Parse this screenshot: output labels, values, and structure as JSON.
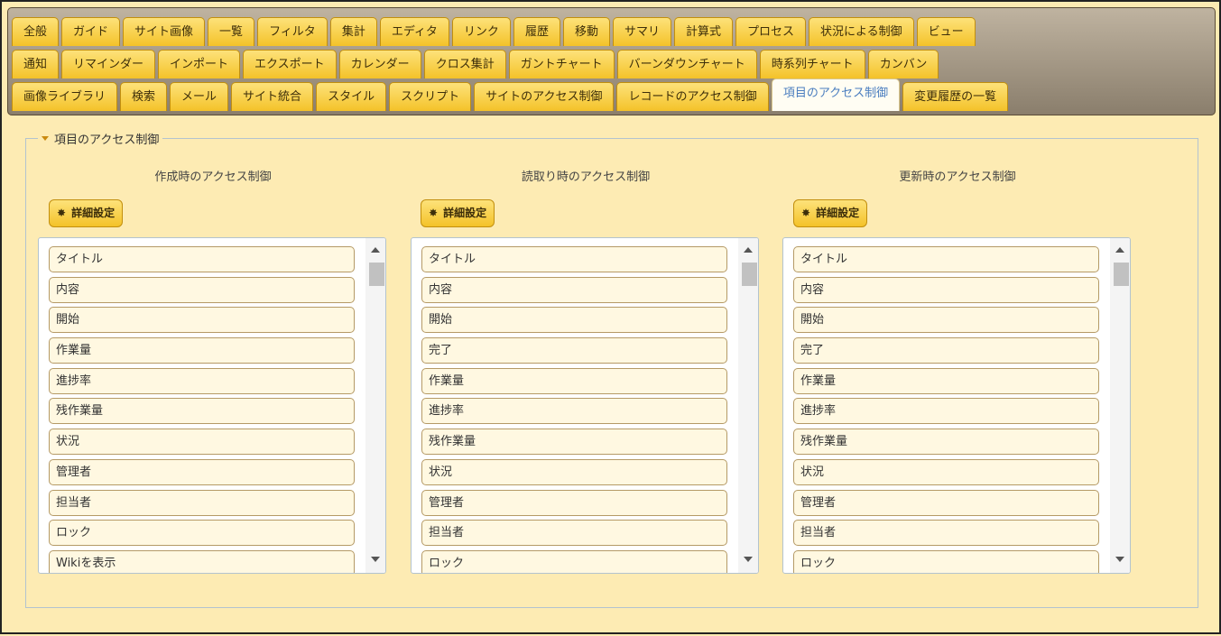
{
  "tabs": {
    "row1": [
      "全般",
      "ガイド",
      "サイト画像",
      "一覧",
      "フィルタ",
      "集計",
      "エディタ",
      "リンク",
      "履歴",
      "移動",
      "サマリ",
      "計算式",
      "プロセス",
      "状況による制御",
      "ビュー"
    ],
    "row2": [
      "通知",
      "リマインダー",
      "インポート",
      "エクスポート",
      "カレンダー",
      "クロス集計",
      "ガントチャート",
      "バーンダウンチャート",
      "時系列チャート",
      "カンバン"
    ],
    "row3": [
      "画像ライブラリ",
      "検索",
      "メール",
      "サイト統合",
      "スタイル",
      "スクリプト",
      "サイトのアクセス制御",
      "レコードのアクセス制御",
      "項目のアクセス制御",
      "変更履歴の一覧"
    ],
    "active": "項目のアクセス制御"
  },
  "section": {
    "legend": "項目のアクセス制御"
  },
  "columns": [
    {
      "title": "作成時のアクセス制御",
      "button_label": "詳細設定",
      "items": [
        "タイトル",
        "内容",
        "開始",
        "作業量",
        "進捗率",
        "残作業量",
        "状況",
        "管理者",
        "担当者",
        "ロック",
        "Wikiを表示"
      ]
    },
    {
      "title": "読取り時のアクセス制御",
      "button_label": "詳細設定",
      "items": [
        "タイトル",
        "内容",
        "開始",
        "完了",
        "作業量",
        "進捗率",
        "残作業量",
        "状況",
        "管理者",
        "担当者",
        "ロック"
      ]
    },
    {
      "title": "更新時のアクセス制御",
      "button_label": "詳細設定",
      "items": [
        "タイトル",
        "内容",
        "開始",
        "完了",
        "作業量",
        "進捗率",
        "残作業量",
        "状況",
        "管理者",
        "担当者",
        "ロック"
      ]
    }
  ],
  "icons": {
    "detail_button_icon": "gear-icon",
    "legend_icon": "caret-down-icon"
  },
  "colors": {
    "background": "#fdebb3",
    "tab": "#f7cb3a",
    "active_tab_text": "#4a7dbf",
    "item_border": "#b59a66"
  }
}
